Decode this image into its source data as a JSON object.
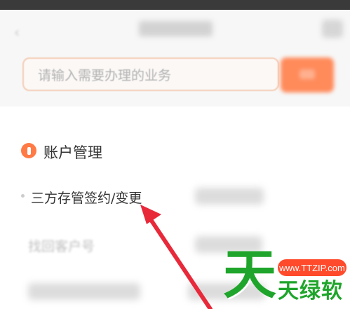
{
  "navbar": {
    "back_icon": "chevron-left-icon",
    "title": "",
    "right_icon": "more-icon"
  },
  "search": {
    "placeholder": "请输入需要办理的业务",
    "button_label": ""
  },
  "section": {
    "icon": "account-icon",
    "title": "账户管理"
  },
  "items": [
    {
      "label": "三方存管签约/变更"
    },
    {
      "label": "找回客户号"
    }
  ],
  "watermark": {
    "url": "www.TTZIP.com",
    "big": "天",
    "small": "天绿软"
  },
  "colors": {
    "accent": "#ff7a45",
    "arrow": "#e8293a",
    "watermark_green": "#1fa52b",
    "watermark_red": "#ff4a2c"
  }
}
